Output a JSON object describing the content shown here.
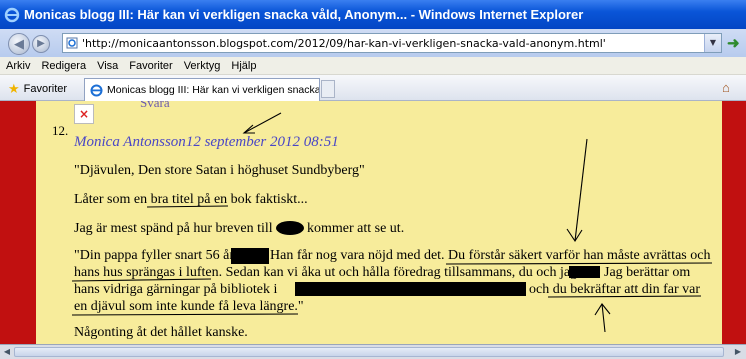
{
  "window": {
    "title": "Monicas blogg III: Här kan vi verkligen snacka våld, Anonym... - Windows Internet Explorer"
  },
  "address": {
    "url": "'http://monicaantonsson.blogspot.com/2012/09/har-kan-vi-verkligen-snacka-vald-anonym.html'"
  },
  "menu": {
    "items": [
      "Arkiv",
      "Redigera",
      "Visa",
      "Favoriter",
      "Verktyg",
      "Hjälp"
    ]
  },
  "favorites": {
    "label": "Favoriter"
  },
  "tab": {
    "label": "Monicas blogg III: Här kan vi verkligen snacka våld, A..."
  },
  "comment": {
    "svara_top": "Svara",
    "number": "12.",
    "author": "Monica Antonsson",
    "date": "12 september 2012 08:51",
    "p1": "\"Djävulen, Den store Satan i höghuset Sundbyberg\"",
    "p2": "Låter som en bra titel på en bok faktiskt...",
    "p3a": "Jag är mest spänd på hur breven till",
    "p3b": "kommer att se ut.",
    "q1a": "\"Din pappa fyller snart 56 år",
    "q1b": "Han får nog vara nöjd med det. Du förstår säkert varför han måste avrättas och",
    "q2a": "hans hus sprängas i luften. Sedan kan vi åka ut och hålla föredrag tillsammans, du och jag,",
    "q2b": "Jag berättar om",
    "q3a": "hans vidriga gärningar på bibliotek i",
    "q3b": "och du bekräftar att din far var",
    "q4": "en djävul som inte kunde få leva längre.\"",
    "p5": "Någonting åt det hållet kanske."
  },
  "icons": {
    "back": "back-arrow-icon",
    "forward": "forward-arrow-icon",
    "page": "ie-page-icon",
    "go": "go-arrow-icon",
    "favorites": "star-icon",
    "home": "home-icon",
    "broken_image": "broken-image-icon"
  },
  "colors": {
    "blog_background": "#f7ec9b",
    "blog_border": "#c11010",
    "author_link": "#4a47c6",
    "titlebar": "#0a55d8"
  }
}
